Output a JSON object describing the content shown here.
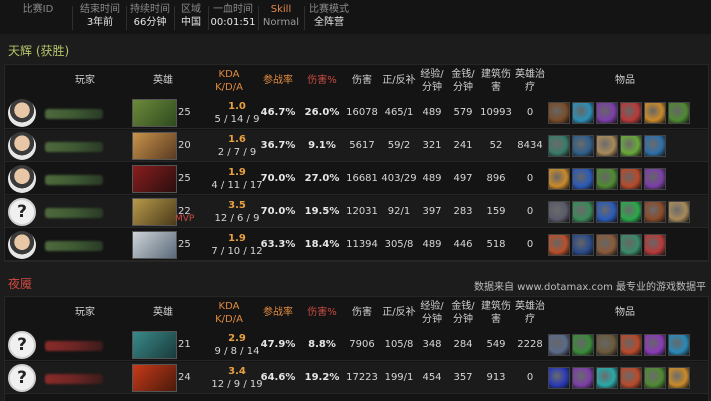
{
  "top_bar": {
    "cells": [
      {
        "label": "比赛ID",
        "value": ""
      },
      {
        "label": "结束时间",
        "value": "3年前"
      },
      {
        "label": "持续时间",
        "value": "66分钟"
      },
      {
        "label": "区域",
        "value": "中国"
      },
      {
        "label": "一血时间",
        "value": "00:01:51"
      },
      {
        "label": "Skill",
        "value": "Normal"
      },
      {
        "label": "比赛模式",
        "value": "全阵营"
      }
    ]
  },
  "radiant": {
    "title": "天辉 (获胜)",
    "headers": {
      "player": "玩家",
      "hero": "英雄",
      "kda_top": "KDA",
      "kda_bottom": "K/D/A",
      "participation": "参战率",
      "damage_pct": "伤害%",
      "damage": "伤害",
      "lh_dn": "正/反补",
      "xpm_top": "经验/",
      "xpm_bottom": "分钟",
      "gpm_top": "金钱/",
      "gpm_bottom": "分钟",
      "building_top": "建筑伤",
      "building_bottom": "害",
      "heal_top": "英雄治",
      "heal_bottom": "疗",
      "items": "物品"
    },
    "rows": [
      {
        "avatar": "face",
        "level": "25",
        "mvp": "",
        "kda_ratio": "1.0",
        "kda": "5 / 14 / 9",
        "participation": "46.7%",
        "damage_pct": "26.0%",
        "damage": "16078",
        "lh_dn": "465/1",
        "xpm": "489",
        "gpm": "579",
        "building": "10993",
        "heal": "0",
        "hero_colors": [
          "#6c8a3a",
          "#2f4a1f"
        ],
        "item_colors": [
          "#7a4d2a",
          "#2c8fb5",
          "#7b3fa8",
          "#b83a3a",
          "#c98a2a",
          "#4f8a33"
        ]
      },
      {
        "avatar": "face",
        "level": "20",
        "mvp": "",
        "kda_ratio": "1.6",
        "kda": "2 / 7 / 9",
        "participation": "36.7%",
        "damage_pct": "9.1%",
        "damage": "5617",
        "lh_dn": "59/2",
        "xpm": "321",
        "gpm": "241",
        "building": "52",
        "heal": "8434",
        "hero_colors": [
          "#c9944a",
          "#5a3a22"
        ],
        "item_colors": [
          "#3a7a6a",
          "#2f5f8a",
          "#a88a5a",
          "#6aa83a",
          "#2f6fa8"
        ]
      },
      {
        "avatar": "face",
        "level": "25",
        "mvp": "",
        "kda_ratio": "1.9",
        "kda": "4 / 11 / 17",
        "participation": "70.0%",
        "damage_pct": "27.0%",
        "damage": "16681",
        "lh_dn": "403/29",
        "xpm": "489",
        "gpm": "497",
        "building": "896",
        "heal": "0",
        "hero_colors": [
          "#8a1e1e",
          "#2a0e0e"
        ],
        "item_colors": [
          "#c98a2a",
          "#2a5ab8",
          "#4f8a33",
          "#b84a2a",
          "#7b3fa8"
        ]
      },
      {
        "avatar": "unknown",
        "level": "22",
        "mvp": "MVP",
        "kda_ratio": "3.5",
        "kda": "12 / 6 / 9",
        "participation": "70.0%",
        "damage_pct": "19.5%",
        "damage": "12031",
        "lh_dn": "92/1",
        "xpm": "397",
        "gpm": "283",
        "building": "159",
        "heal": "0",
        "hero_colors": [
          "#b89a4a",
          "#4a3a1a"
        ],
        "item_colors": [
          "#5a5a6a",
          "#3a8a5a",
          "#2a5ab8",
          "#2aa84a",
          "#8a4a2a",
          "#a88a5a"
        ]
      },
      {
        "avatar": "face",
        "level": "25",
        "mvp": "",
        "kda_ratio": "1.9",
        "kda": "7 / 10 / 12",
        "participation": "63.3%",
        "damage_pct": "18.4%",
        "damage": "11394",
        "lh_dn": "305/8",
        "xpm": "489",
        "gpm": "446",
        "building": "518",
        "heal": "0",
        "hero_colors": [
          "#cfd4d8",
          "#5a6a7a"
        ],
        "item_colors": [
          "#b8502a",
          "#2a4a8a",
          "#8a5a3a",
          "#3a8a6a",
          "#b83a3a"
        ]
      }
    ]
  },
  "credit": "数据来自 www.dotamax.com 最专业的游戏数据平台",
  "dire": {
    "title": "夜魇",
    "headers": {
      "player": "玩家",
      "hero": "英雄",
      "kda_top": "KDA",
      "kda_bottom": "K/D/A",
      "participation": "参战率",
      "damage_pct": "伤害%",
      "damage": "伤害",
      "lh_dn": "正/反补",
      "xpm_top": "经验/",
      "xpm_bottom": "分钟",
      "gpm_top": "金钱/",
      "gpm_bottom": "分钟",
      "building_top": "建筑伤",
      "building_bottom": "害",
      "heal_top": "英雄治",
      "heal_bottom": "疗",
      "items": "物品"
    },
    "rows": [
      {
        "avatar": "unknown",
        "level": "21",
        "mvp": "",
        "kda_ratio": "2.9",
        "kda": "9 / 8 / 14",
        "participation": "47.9%",
        "damage_pct": "8.8%",
        "damage": "7906",
        "lh_dn": "105/8",
        "xpm": "348",
        "gpm": "284",
        "building": "549",
        "heal": "2228",
        "hero_colors": [
          "#3a8a8a",
          "#1a3a3a"
        ],
        "item_colors": [
          "#5a6a8a",
          "#3a8a3a",
          "#6a5a3a",
          "#b84a2a",
          "#8a3ab8",
          "#2a8ab8"
        ]
      },
      {
        "avatar": "unknown",
        "level": "24",
        "mvp": "",
        "kda_ratio": "3.4",
        "kda": "12 / 9 / 19",
        "participation": "64.6%",
        "damage_pct": "19.2%",
        "damage": "17223",
        "lh_dn": "199/1",
        "xpm": "454",
        "gpm": "357",
        "building": "913",
        "heal": "0",
        "hero_colors": [
          "#c83a1a",
          "#4a1a0a"
        ],
        "item_colors": [
          "#2a3ab8",
          "#7b3fa8",
          "#2aa8a8",
          "#b84a2a",
          "#4f8a33",
          "#c98a2a"
        ]
      }
    ]
  }
}
